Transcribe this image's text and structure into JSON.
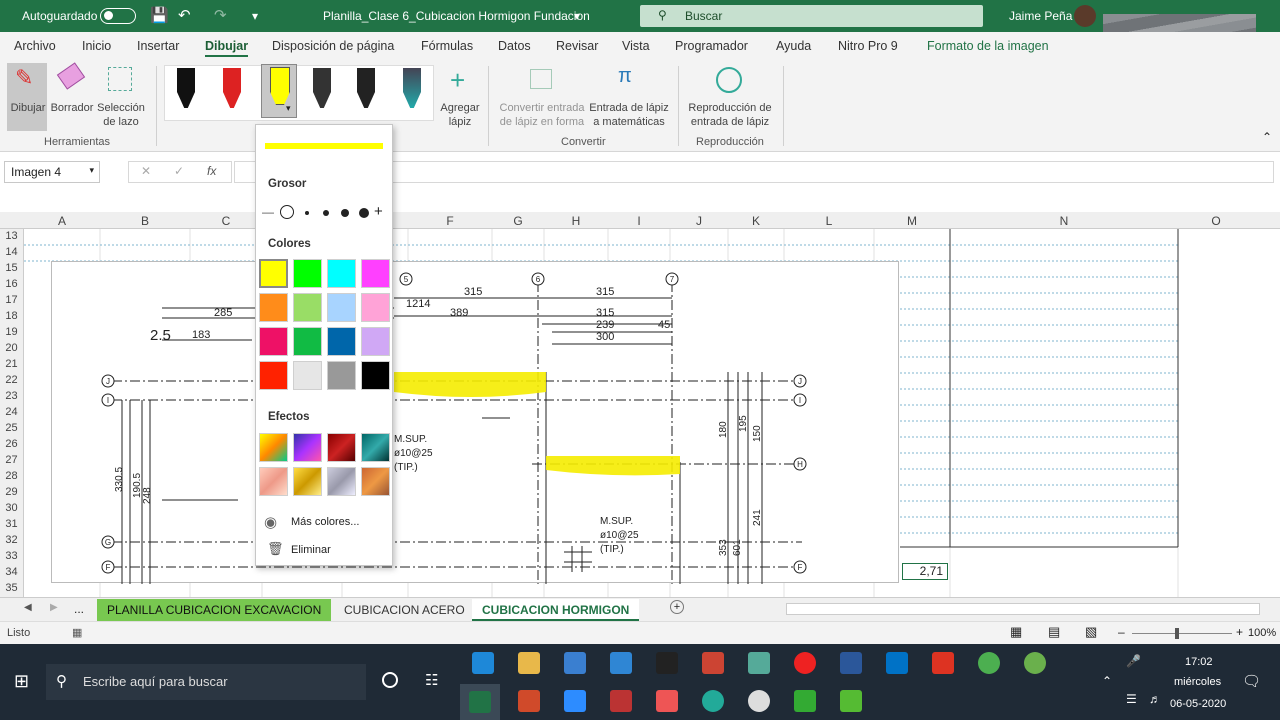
{
  "titlebar": {
    "autosave_label": "Autoguardado",
    "doc_title": "Planilla_Clase 6_Cubicacion Hormigon Fundacion",
    "search_label": "Buscar",
    "user": "Jaime Peña"
  },
  "menu": [
    "Archivo",
    "Inicio",
    "Insertar",
    "Dibujar",
    "Disposición de página",
    "Fórmulas",
    "Datos",
    "Revisar",
    "Vista",
    "Programador",
    "Ayuda",
    "Nitro Pro 9",
    "Formato de la imagen"
  ],
  "ribbon": {
    "draw": "Dibujar",
    "eraser": "Borrador",
    "lasso": "Selección de lazo",
    "tools_group": "Herramientas",
    "add_pen": "Agregar lápiz",
    "convert_shape": "Convertir entrada de lápiz en forma",
    "math_input": "Entrada de lápiz a matemáticas",
    "convert_group": "Convertir",
    "replay": "Reproducción de entrada de lápiz",
    "replay_group": "Reproducción"
  },
  "formula": {
    "name_box": "Imagen 4",
    "fx": "fx"
  },
  "columns": [
    "A",
    "B",
    "C",
    "D",
    "E",
    "F",
    "G",
    "H",
    "I",
    "J",
    "K",
    "L",
    "M",
    "N",
    "O"
  ],
  "rows": [
    "13",
    "14",
    "15",
    "16",
    "17",
    "18",
    "19",
    "20",
    "21",
    "22",
    "23",
    "24",
    "25",
    "26",
    "27",
    "28",
    "29",
    "30",
    "31",
    "32",
    "33",
    "34",
    "35"
  ],
  "cell_value": "2,71",
  "drawing_labels": {
    "d1": "285",
    "d2": "183",
    "d3": "2.5",
    "d4": "1214",
    "d5": "315",
    "d6": "315",
    "d7": "389",
    "d8": "315",
    "d9": "239",
    "d10": "45",
    "d11": "300",
    "msup1": "M.SUP.",
    "msup1b": "ø10@25",
    "msup1c": "(TIP.)",
    "msup2": "M.SUP.",
    "msup2b": "ø10@25",
    "msup2c": "(TIP.)",
    "v1": "330.5",
    "v2": "190.5",
    "v3": "248",
    "v4": "180",
    "v5": "195",
    "v6": "150",
    "v7": "241",
    "v8": "353",
    "v9": "601",
    "c5": "5",
    "c6": "6",
    "c7": "7",
    "r_j": "J",
    "r_i": "I",
    "r_h": "H",
    "r_g": "G",
    "r_f": "F"
  },
  "dropdown": {
    "thickness": "Grosor",
    "colors": "Colores",
    "effects": "Efectos",
    "more_colors": "Más colores...",
    "remove": "Eliminar"
  },
  "color_swatches": [
    "#ffff00",
    "#00ff00",
    "#00ffff",
    "#ff40ff",
    "#ff8c1a",
    "#99dd66",
    "#a8d4ff",
    "#ffa3d7",
    "#ee1166",
    "#11bb44",
    "#0066aa",
    "#d0a8f5",
    "#ff2200",
    "#e6e6e6",
    "#999999",
    "#000000"
  ],
  "sheet_tabs": [
    "PLANILLA CUBICACION EXCAVACION",
    "CUBICACION ACERO",
    "CUBICACION HORMIGON"
  ],
  "status": {
    "ready": "Listo",
    "zoom": "100%"
  },
  "taskbar": {
    "search": "Escribe aquí para buscar",
    "time": "17:02",
    "day": "miércoles",
    "date": "06-05-2020"
  }
}
